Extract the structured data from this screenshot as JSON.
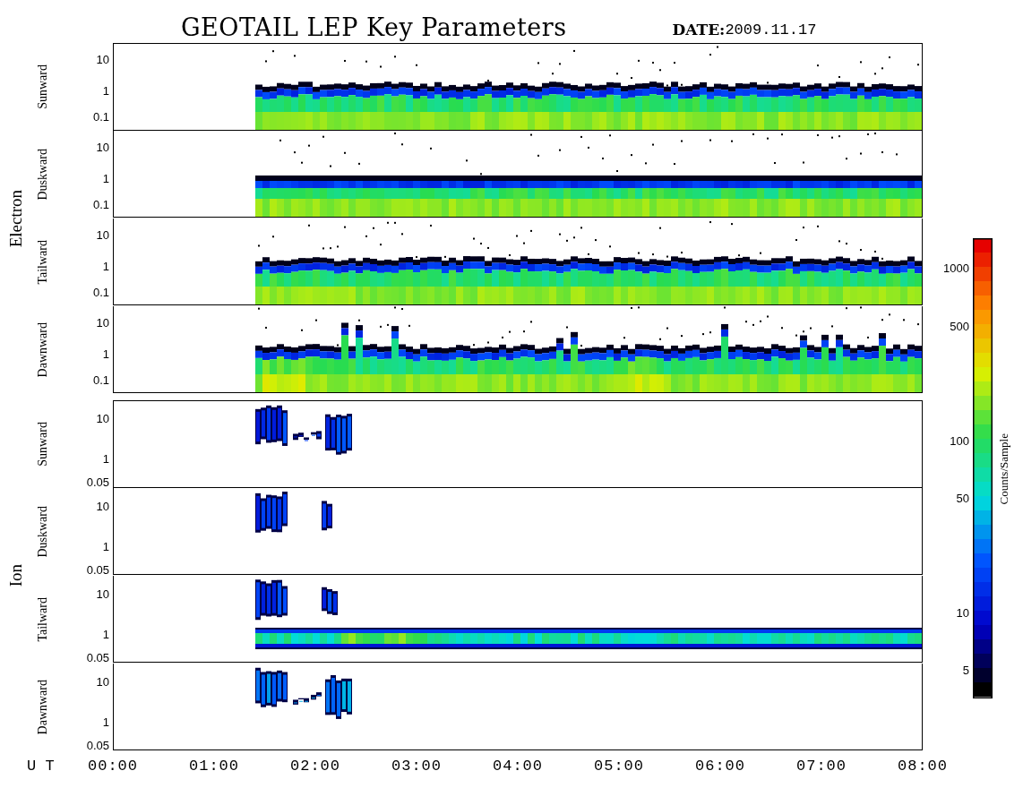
{
  "title": "GEOTAIL LEP Key Parameters",
  "date_label": "DATE:",
  "date": "2009.11.17",
  "groups": [
    {
      "kind": "electron",
      "name": "Electron",
      "panels": [
        {
          "direction": "Sunward",
          "yticks": [
            "10",
            "1",
            "0.1"
          ]
        },
        {
          "direction": "Duskward",
          "yticks": [
            "10",
            "1",
            "0.1"
          ]
        },
        {
          "direction": "Tailward",
          "yticks": [
            "10",
            "1",
            "0.1"
          ]
        },
        {
          "direction": "Dawnward",
          "yticks": [
            "10",
            "1",
            "0.1"
          ]
        }
      ]
    },
    {
      "kind": "ion",
      "name": "Ion",
      "panels": [
        {
          "direction": "Sunward",
          "yticks": [
            "10",
            "1",
            "0.05"
          ]
        },
        {
          "direction": "Duskward",
          "yticks": [
            "10",
            "1",
            "0.05"
          ]
        },
        {
          "direction": "Tailward",
          "yticks": [
            "10",
            "1",
            "0.05"
          ]
        },
        {
          "direction": "Dawnward",
          "yticks": [
            "10",
            "1",
            "0.05"
          ]
        }
      ]
    }
  ],
  "time_axis": {
    "label": "U T",
    "ticks": [
      "00:00",
      "01:00",
      "02:00",
      "03:00",
      "04:00",
      "05:00",
      "06:00",
      "07:00",
      "08:00"
    ]
  },
  "colorbar": {
    "label": "Counts/Sample",
    "ticks": [
      "1000",
      "500",
      "100",
      "50",
      "10",
      "5"
    ]
  }
}
